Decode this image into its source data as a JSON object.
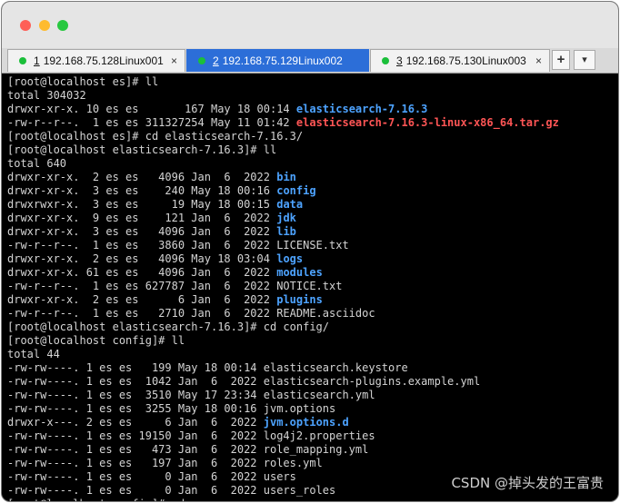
{
  "tabs": [
    {
      "num": "1",
      "label": "192.168.75.128Linux001",
      "close": "×",
      "active": false
    },
    {
      "num": "2",
      "label": "192.168.75.129Linux002",
      "close": "×",
      "active": true
    },
    {
      "num": "3",
      "label": "192.168.75.130Linux003",
      "close": "×",
      "active": false
    }
  ],
  "tab_add": "+",
  "tab_menu": "▾",
  "terminal": {
    "lines": [
      {
        "pre": "[root@localhost es]# ll",
        "name": "",
        "style": ""
      },
      {
        "pre": "total 304032",
        "name": "",
        "style": ""
      },
      {
        "pre": "drwxr-xr-x. 10 es es       167 May 18 00:14 ",
        "name": "elasticsearch-7.16.3",
        "style": "dir"
      },
      {
        "pre": "-rw-r--r--.  1 es es 311327254 May 11 01:42 ",
        "name": "elasticsearch-7.16.3-linux-x86_64.tar.gz",
        "style": "archive"
      },
      {
        "pre": "[root@localhost es]# cd elasticsearch-7.16.3/",
        "name": "",
        "style": ""
      },
      {
        "pre": "[root@localhost elasticsearch-7.16.3]# ll",
        "name": "",
        "style": ""
      },
      {
        "pre": "total 640",
        "name": "",
        "style": ""
      },
      {
        "pre": "drwxr-xr-x.  2 es es   4096 Jan  6  2022 ",
        "name": "bin",
        "style": "dir"
      },
      {
        "pre": "drwxr-xr-x.  3 es es    240 May 18 00:16 ",
        "name": "config",
        "style": "dir"
      },
      {
        "pre": "drwxrwxr-x.  3 es es     19 May 18 00:15 ",
        "name": "data",
        "style": "dir"
      },
      {
        "pre": "drwxr-xr-x.  9 es es    121 Jan  6  2022 ",
        "name": "jdk",
        "style": "dir"
      },
      {
        "pre": "drwxr-xr-x.  3 es es   4096 Jan  6  2022 ",
        "name": "lib",
        "style": "dir"
      },
      {
        "pre": "-rw-r--r--.  1 es es   3860 Jan  6  2022 LICENSE.txt",
        "name": "",
        "style": ""
      },
      {
        "pre": "drwxr-xr-x.  2 es es   4096 May 18 03:04 ",
        "name": "logs",
        "style": "dir"
      },
      {
        "pre": "drwxr-xr-x. 61 es es   4096 Jan  6  2022 ",
        "name": "modules",
        "style": "dir"
      },
      {
        "pre": "-rw-r--r--.  1 es es 627787 Jan  6  2022 NOTICE.txt",
        "name": "",
        "style": ""
      },
      {
        "pre": "drwxr-xr-x.  2 es es      6 Jan  6  2022 ",
        "name": "plugins",
        "style": "dir"
      },
      {
        "pre": "-rw-r--r--.  1 es es   2710 Jan  6  2022 README.asciidoc",
        "name": "",
        "style": ""
      },
      {
        "pre": "[root@localhost elasticsearch-7.16.3]# cd config/",
        "name": "",
        "style": ""
      },
      {
        "pre": "[root@localhost config]# ll",
        "name": "",
        "style": ""
      },
      {
        "pre": "total 44",
        "name": "",
        "style": ""
      },
      {
        "pre": "-rw-rw----. 1 es es   199 May 18 00:14 elasticsearch.keystore",
        "name": "",
        "style": ""
      },
      {
        "pre": "-rw-rw----. 1 es es  1042 Jan  6  2022 elasticsearch-plugins.example.yml",
        "name": "",
        "style": ""
      },
      {
        "pre": "-rw-rw----. 1 es es  3510 May 17 23:34 elasticsearch.yml",
        "name": "",
        "style": ""
      },
      {
        "pre": "-rw-rw----. 1 es es  3255 May 18 00:16 jvm.options",
        "name": "",
        "style": ""
      },
      {
        "pre": "drwxr-x---. 2 es es     6 Jan  6  2022 ",
        "name": "jvm.options.d",
        "style": "dir"
      },
      {
        "pre": "-rw-rw----. 1 es es 19150 Jan  6  2022 log4j2.properties",
        "name": "",
        "style": ""
      },
      {
        "pre": "-rw-rw----. 1 es es   473 Jan  6  2022 role_mapping.yml",
        "name": "",
        "style": ""
      },
      {
        "pre": "-rw-rw----. 1 es es   197 Jan  6  2022 roles.yml",
        "name": "",
        "style": ""
      },
      {
        "pre": "-rw-rw----. 1 es es     0 Jan  6  2022 users",
        "name": "",
        "style": ""
      },
      {
        "pre": "-rw-rw----. 1 es es     0 Jan  6  2022 users_roles",
        "name": "",
        "style": ""
      },
      {
        "pre": "[root@localhost config]# cd ..",
        "name": "",
        "style": ""
      }
    ]
  },
  "watermark": "CSDN @掉头发的王富贵",
  "colors": {
    "terminal_bg": "#000000",
    "terminal_fg": "#d4d4d4",
    "directory": "#4da3ff",
    "archive": "#ff5555",
    "active_tab": "#2c6ed8",
    "session_dot": "#1bbf3a"
  }
}
